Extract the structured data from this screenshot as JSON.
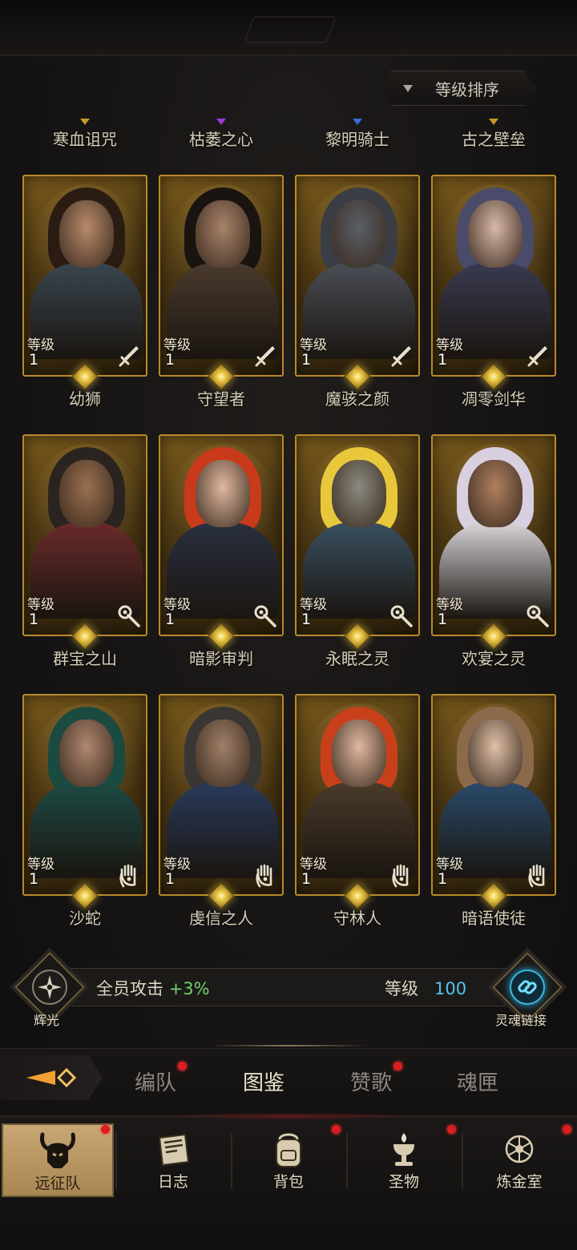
{
  "sort": {
    "label": "等级排序"
  },
  "cards": [
    {
      "title": "寒血诅咒",
      "name": "幼狮",
      "level_label": "等级",
      "level": "1",
      "class_icon": "sword-icon",
      "gem_color": "#c49a2a",
      "hair": "#2a1c12",
      "skin": "#b88a6a",
      "body": "#3a4650"
    },
    {
      "title": "枯萎之心",
      "name": "守望者",
      "level_label": "等级",
      "level": "1",
      "class_icon": "sword-icon",
      "gem_color": "#9a3ad8",
      "hair": "#1a1410",
      "skin": "#a8836a",
      "body": "#4a3a2c"
    },
    {
      "title": "黎明骑士",
      "name": "魔骇之颜",
      "level_label": "等级",
      "level": "1",
      "class_icon": "sword-icon",
      "gem_color": "#3a6ad8",
      "hair": "#3a3e44",
      "skin": "#5a5e66",
      "body": "#4a4e56"
    },
    {
      "title": "古之壁垒",
      "name": "凋零剑华",
      "level_label": "等级",
      "level": "1",
      "class_icon": "sword-icon",
      "gem_color": "#c49a2a",
      "hair": "#4a4a6a",
      "skin": "#d8b8a8",
      "body": "#3a3a50"
    },
    {
      "title": "",
      "name": "群宝之山",
      "level_label": "等级",
      "level": "1",
      "class_icon": "staff-icon",
      "gem_color": "",
      "hair": "#2a2420",
      "skin": "#9a7050",
      "body": "#6a2a2a"
    },
    {
      "title": "",
      "name": "暗影审判",
      "level_label": "等级",
      "level": "1",
      "class_icon": "staff-icon",
      "gem_color": "",
      "hair": "#c83a1a",
      "skin": "#e0b8a0",
      "body": "#2a3040"
    },
    {
      "title": "",
      "name": "永眠之灵",
      "level_label": "等级",
      "level": "1",
      "class_icon": "staff-icon",
      "gem_color": "",
      "hair": "#e8c83a",
      "skin": "#8a8a80",
      "body": "#3a5060"
    },
    {
      "title": "",
      "name": "欢宴之灵",
      "level_label": "等级",
      "level": "1",
      "class_icon": "staff-icon",
      "gem_color": "",
      "hair": "#d8d0e0",
      "skin": "#b08060",
      "body": "#d8d4d8"
    },
    {
      "title": "",
      "name": "沙蛇",
      "level_label": "等级",
      "level": "1",
      "class_icon": "hand-icon",
      "gem_color": "",
      "hair": "#1a4a40",
      "skin": "#b08870",
      "body": "#1e4a44"
    },
    {
      "title": "",
      "name": "虔信之人",
      "level_label": "等级",
      "level": "1",
      "class_icon": "hand-icon",
      "gem_color": "",
      "hair": "#3a3634",
      "skin": "#a08068",
      "body": "#2a3a5a"
    },
    {
      "title": "",
      "name": "守林人",
      "level_label": "等级",
      "level": "1",
      "class_icon": "hand-icon",
      "gem_color": "",
      "hair": "#c8401a",
      "skin": "#e0b8a0",
      "body": "#4a3a2a"
    },
    {
      "title": "",
      "name": "暗语使徒",
      "level_label": "等级",
      "level": "1",
      "class_icon": "hand-icon",
      "gem_color": "",
      "hair": "#8a6a4a",
      "skin": "#e0c0a8",
      "body": "#2a4a6a"
    }
  ],
  "bonus": {
    "left_emblem_label": "辉光",
    "text": "全员攻击",
    "percent": "+3%",
    "level_label": "等级",
    "level_value": "100",
    "right_emblem_label": "灵魂链接"
  },
  "subnav": {
    "tabs": [
      {
        "label": "编队",
        "active": false,
        "dot": true
      },
      {
        "label": "图鉴",
        "active": true,
        "dot": false
      },
      {
        "label": "赞歌",
        "active": false,
        "dot": true
      },
      {
        "label": "魂匣",
        "active": false,
        "dot": false
      }
    ]
  },
  "bottom_tabs": [
    {
      "label": "远征队",
      "icon": "horned-helmet-icon",
      "active": true,
      "dot": true
    },
    {
      "label": "日志",
      "icon": "scroll-icon",
      "active": false,
      "dot": false
    },
    {
      "label": "背包",
      "icon": "backpack-icon",
      "active": false,
      "dot": true
    },
    {
      "label": "圣物",
      "icon": "chalice-icon",
      "active": false,
      "dot": true
    },
    {
      "label": "炼金室",
      "icon": "alchemy-icon",
      "active": false,
      "dot": true
    }
  ],
  "colors": {
    "accent_gold": "#b78a2a",
    "bonus_green": "#6ed26e",
    "level_cyan": "#4ec6e8",
    "notify_red": "#d81e1e"
  }
}
